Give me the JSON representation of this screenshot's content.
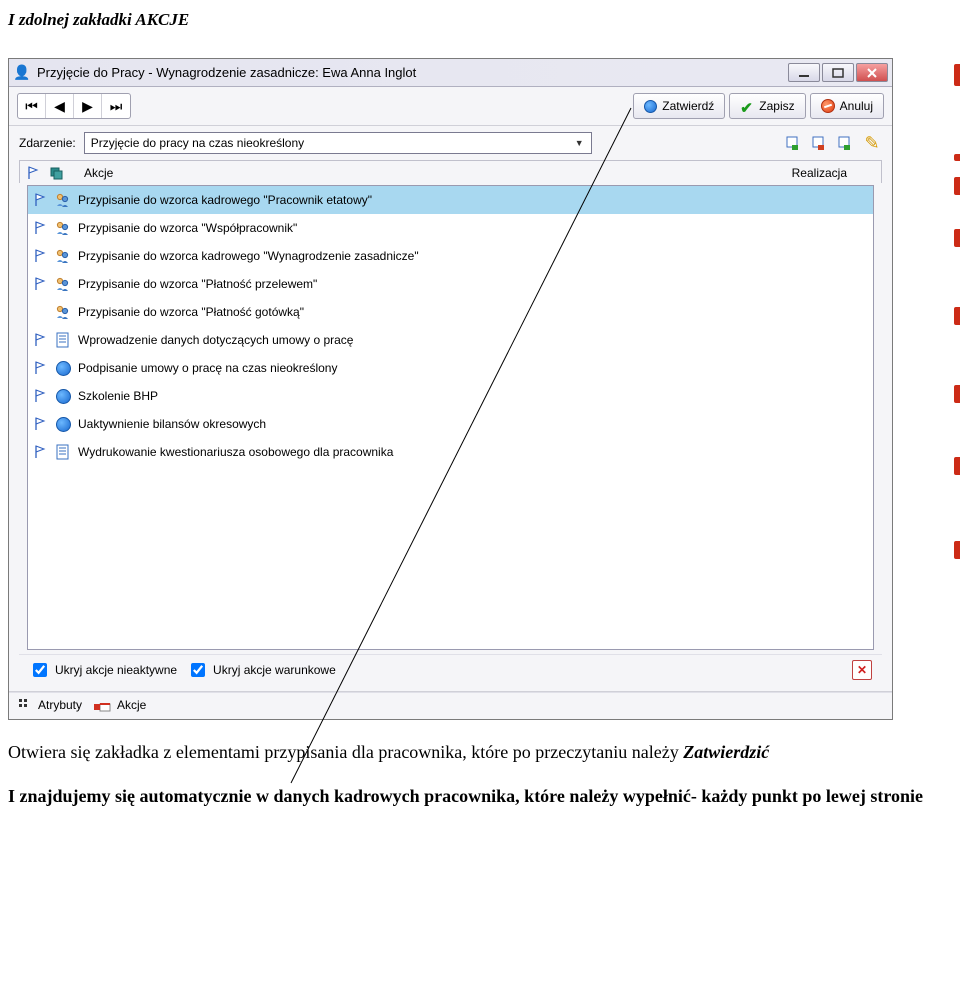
{
  "doc": {
    "title": "I zdolnej zakładki AKCJE",
    "para1_a": "Otwiera się zakładka z elementami przypisania dla pracownika, które po przeczytaniu należy ",
    "para1_b": "Zatwierdzić",
    "para2_a": "I znajdujemy się automatycznie w danych kadrowych pracownika, które należy wypełnić- każdy punkt po lewej stronie"
  },
  "window": {
    "title": "Przyjęcie do Pracy - Wynagrodzenie zasadnicze:  Ewa Anna Inglot",
    "buttons": {
      "zatwierdz": "Zatwierdź",
      "zapisz": "Zapisz",
      "anuluj": "Anuluj"
    },
    "event": {
      "label": "Zdarzenie:",
      "value": "Przyjęcie do pracy na czas nieokreślony"
    },
    "subheader": {
      "akcje": "Akcje",
      "realizacja": "Realizacja"
    },
    "actions": [
      {
        "icon1": "flag",
        "icon2": "people",
        "label": "Przypisanie do wzorca kadrowego \"Pracownik etatowy\"",
        "selected": true
      },
      {
        "icon1": "flag",
        "icon2": "people",
        "label": "Przypisanie do wzorca \"Współpracownik\""
      },
      {
        "icon1": "flag",
        "icon2": "people",
        "label": "Przypisanie do wzorca kadrowego \"Wynagrodzenie zasadnicze\""
      },
      {
        "icon1": "flag",
        "icon2": "people",
        "label": "Przypisanie do wzorca \"Płatność przelewem\""
      },
      {
        "icon1": "",
        "icon2": "people",
        "label": "Przypisanie do wzorca \"Płatność gotówką\""
      },
      {
        "icon1": "flag",
        "icon2": "doc",
        "label": "Wprowadzenie danych dotyczących umowy o pracę"
      },
      {
        "icon1": "flag",
        "icon2": "info",
        "label": "Podpisanie umowy o pracę na czas nieokreślony"
      },
      {
        "icon1": "flag",
        "icon2": "info",
        "label": "Szkolenie BHP"
      },
      {
        "icon1": "flag",
        "icon2": "info",
        "label": "Uaktywnienie bilansów okresowych"
      },
      {
        "icon1": "flag",
        "icon2": "doc",
        "label": "Wydrukowanie kwestionariusza osobowego dla pracownika"
      }
    ],
    "checkboxes": {
      "hide_inactive": {
        "label": "Ukryj akcje nieaktywne",
        "checked": true
      },
      "hide_conditional": {
        "label": "Ukryj akcje warunkowe",
        "checked": true
      }
    },
    "tabs": {
      "atrybuty": "Atrybuty",
      "akcje": "Akcje"
    }
  }
}
